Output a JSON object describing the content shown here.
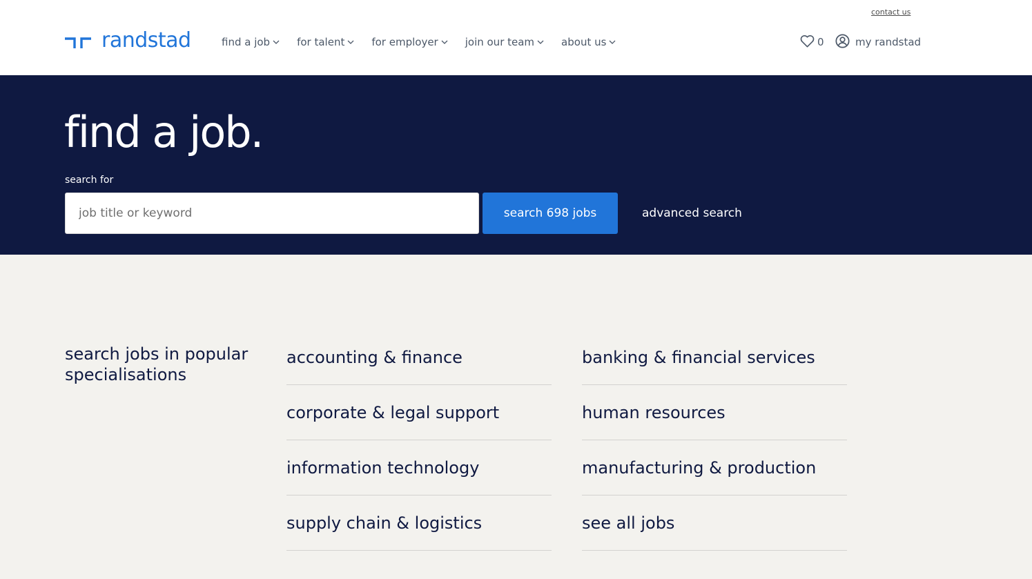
{
  "header": {
    "contact_label": "contact us",
    "logo_text": "randstad",
    "nav": [
      {
        "label": "find a job"
      },
      {
        "label": "for talent"
      },
      {
        "label": "for employer"
      },
      {
        "label": "join our team"
      },
      {
        "label": "about us"
      }
    ],
    "favorites_count": "0",
    "account_label": "my randstad"
  },
  "hero": {
    "title": "find a job.",
    "search_label": "search for",
    "search_placeholder": "job title or keyword",
    "search_value": "",
    "search_button": "search 698 jobs",
    "advanced_search": "advanced search"
  },
  "specialisations": {
    "heading": "search jobs in popular specialisations",
    "column1": [
      {
        "label": "accounting & finance"
      },
      {
        "label": "corporate & legal support"
      },
      {
        "label": "information technology"
      },
      {
        "label": "supply chain & logistics"
      }
    ],
    "column2": [
      {
        "label": "banking & financial services"
      },
      {
        "label": "human resources"
      },
      {
        "label": "manufacturing & production"
      },
      {
        "label": "see all jobs"
      }
    ]
  },
  "colors": {
    "brand_blue": "#2175d9",
    "hero_navy": "#0f1941",
    "page_bg": "#f3f2ee"
  },
  "icons": {
    "logo": "randstad-logo-icon",
    "favorites": "heart-icon",
    "account": "user-circle-icon",
    "nav_dropdown": "chevron-down-icon"
  }
}
